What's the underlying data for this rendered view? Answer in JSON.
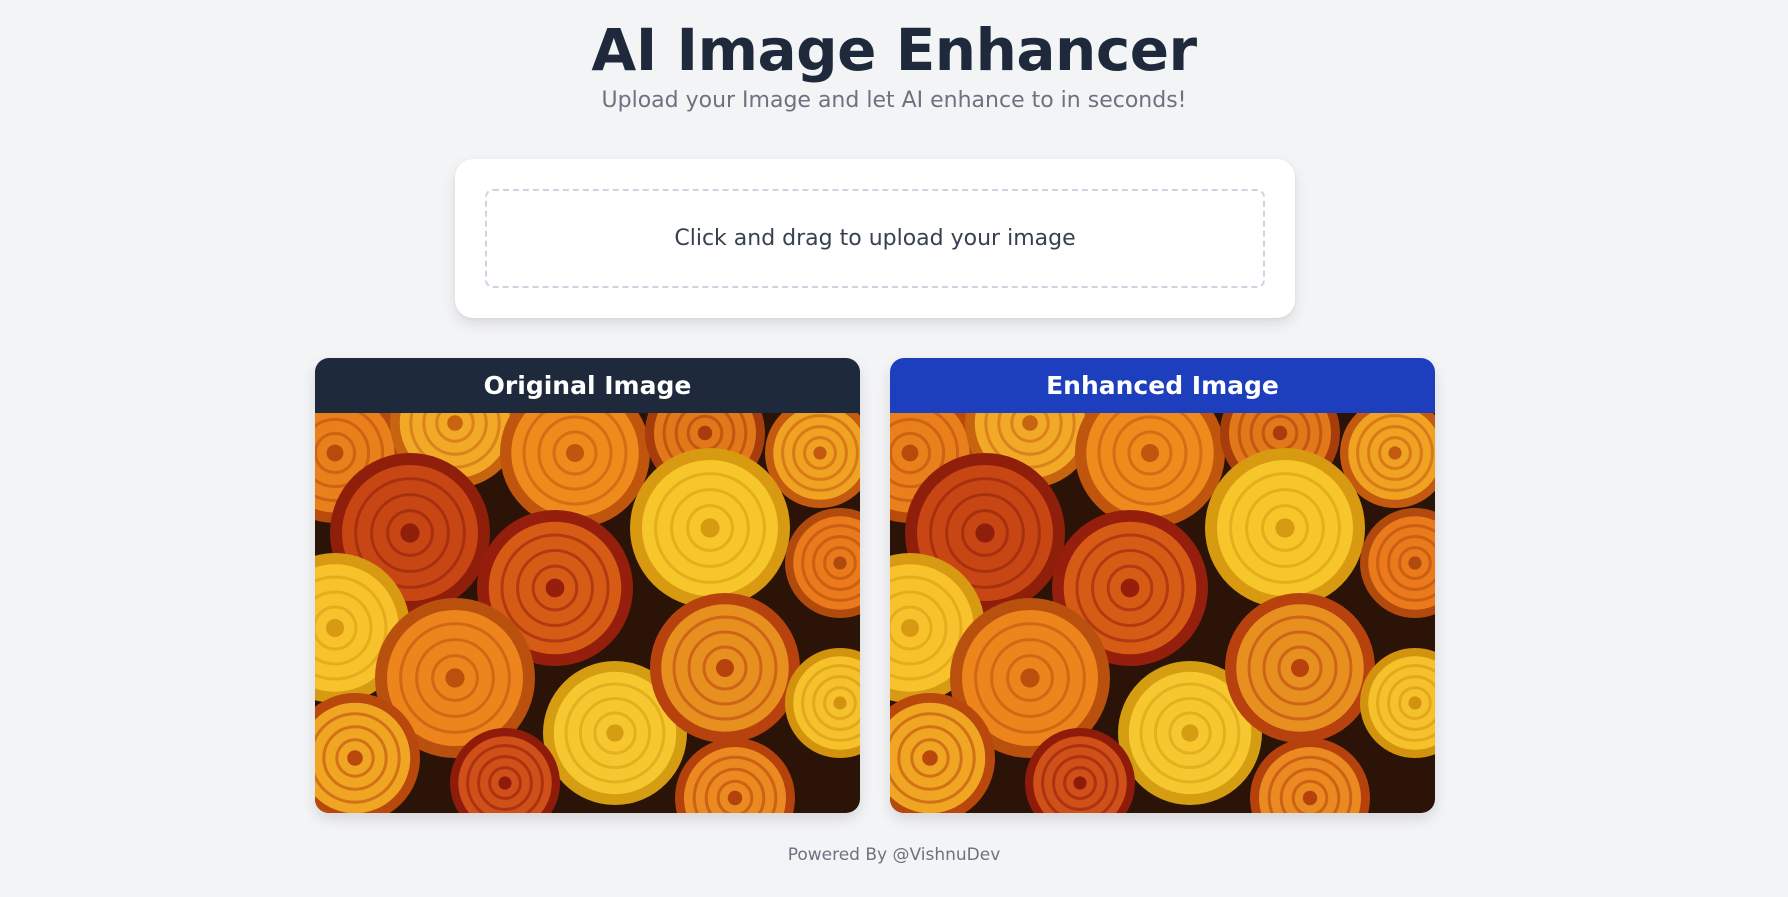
{
  "header": {
    "title": "AI Image Enhancer",
    "subtitle": "Upload your Image and let AI enhance to in seconds!"
  },
  "upload": {
    "prompt": "Click and drag to upload your image"
  },
  "panels": {
    "original": {
      "label": "Original Image",
      "header_color": "#1e293b"
    },
    "enhanced": {
      "label": "Enhanced Image",
      "header_color": "#1d3fbd"
    }
  },
  "footer": {
    "text": "Powered By @VishnuDev"
  },
  "colors": {
    "background": "#f3f4f6",
    "title": "#1e293b",
    "muted": "#6b7280"
  }
}
